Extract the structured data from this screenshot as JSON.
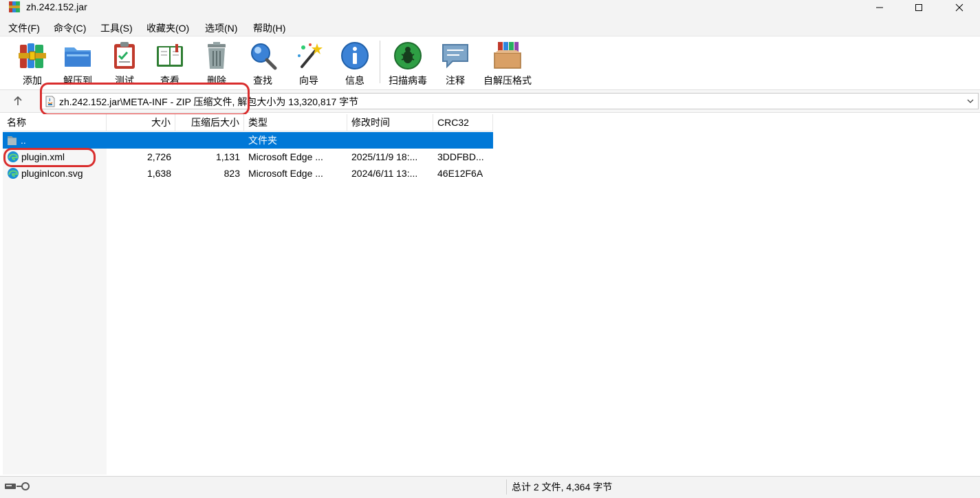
{
  "window": {
    "title": "zh.242.152.jar"
  },
  "menu": {
    "items": [
      "文件(F)",
      "命令(C)",
      "工具(S)",
      "收藏夹(O)",
      "选项(N)",
      "帮助(H)"
    ]
  },
  "toolbar": {
    "add": "添加",
    "extract": "解压到",
    "test": "测试",
    "view": "查看",
    "delete": "删除",
    "find": "查找",
    "wizard": "向导",
    "info": "信息",
    "scan": "扫描病毒",
    "comment": "注释",
    "sfx": "自解压格式"
  },
  "address": {
    "path": "zh.242.152.jar\\META-INF - ZIP 压缩文件, 解包大小为 13,320,817 字节"
  },
  "list": {
    "columns": {
      "name": "名称",
      "size": "大小",
      "packed": "压缩后大小",
      "type": "类型",
      "modified": "修改时间",
      "crc": "CRC32"
    },
    "rows": [
      {
        "name": "..",
        "size": "",
        "packed": "",
        "type": "文件夹",
        "modified": "",
        "crc": ""
      },
      {
        "name": "plugin.xml",
        "size": "2,726",
        "packed": "1,131",
        "type": "Microsoft Edge ...",
        "modified": "2025/11/9 18:...",
        "crc": "3DDFBD..."
      },
      {
        "name": "pluginIcon.svg",
        "size": "1,638",
        "packed": "823",
        "type": "Microsoft Edge ...",
        "modified": "2024/6/11 13:...",
        "crc": "46E12F6A"
      }
    ]
  },
  "status": {
    "summary": "总计 2 文件, 4,364 字节"
  },
  "colors": {
    "selection": "#0078d7",
    "annotation": "#d92d2d"
  }
}
